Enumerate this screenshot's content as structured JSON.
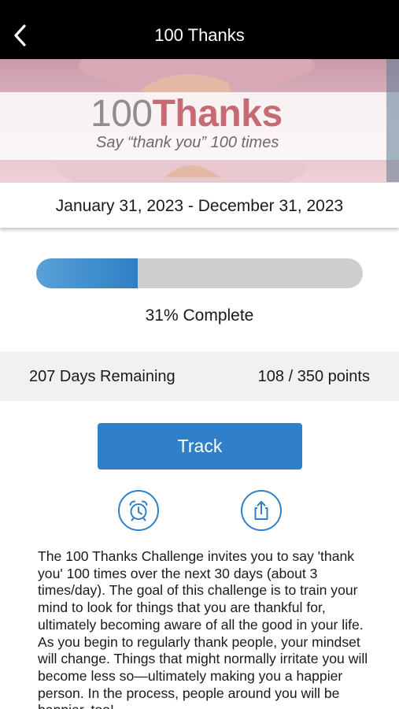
{
  "nav": {
    "title": "100 Thanks",
    "back_icon": "chevron-left-icon"
  },
  "hero": {
    "title_number": "100",
    "title_word": "Thanks",
    "subtitle": "Say “thank you” 100 times"
  },
  "challenge": {
    "date_range": "January 31, 2023 - December 31, 2023",
    "progress_fraction": 0.31,
    "progress_label": "31% Complete",
    "days_remaining": "207 Days Remaining",
    "points": "108 / 350 points",
    "accent_color": "#2f80c8"
  },
  "actions": {
    "track_label": "Track",
    "alarm_icon": "alarm-clock-icon",
    "share_icon": "share-icon"
  },
  "description": "The 100 Thanks Challenge invites you to say 'thank you' 100 times over the next 30 days (about 3 times/day). The goal of this challenge is to train your mind to look for things that you are thankful for, ultimately becoming aware of all the good in your life. As you begin to regularly thank people, your mindset will change. Things that might normally irritate you will become less so—ultimately making you a happier person. In the process, people around you will be happier, too!"
}
